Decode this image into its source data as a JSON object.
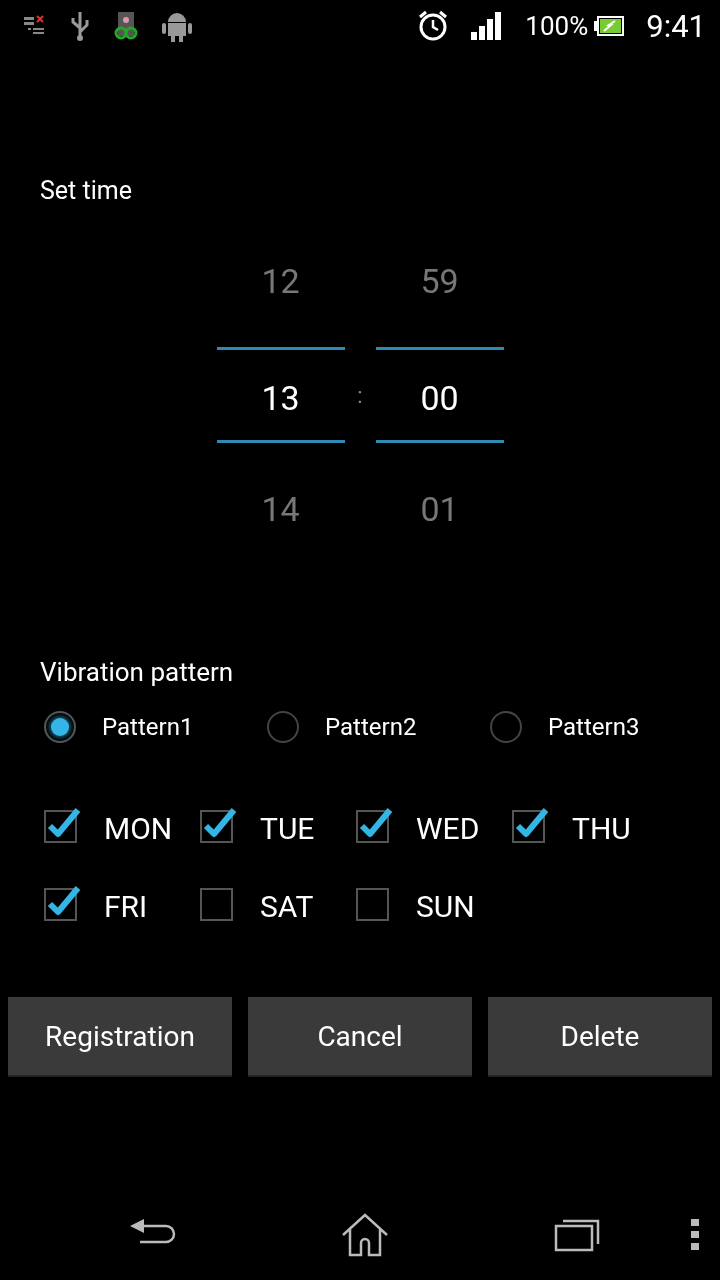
{
  "status_bar": {
    "battery_percent": "100%",
    "time": "9:41"
  },
  "title": "Set time",
  "time_picker": {
    "hours": [
      "12",
      "13",
      "14"
    ],
    "separator": ":",
    "minutes": [
      "59",
      "00",
      "01"
    ]
  },
  "vibration": {
    "label": "Vibration pattern",
    "patterns": [
      {
        "label": "Pattern1",
        "selected": true
      },
      {
        "label": "Pattern2",
        "selected": false
      },
      {
        "label": "Pattern3",
        "selected": false
      }
    ]
  },
  "days": [
    {
      "label": "MON",
      "checked": true
    },
    {
      "label": "TUE",
      "checked": true
    },
    {
      "label": "WED",
      "checked": true
    },
    {
      "label": "THU",
      "checked": true
    },
    {
      "label": "FRI",
      "checked": true
    },
    {
      "label": "SAT",
      "checked": false
    },
    {
      "label": "SUN",
      "checked": false
    }
  ],
  "buttons": [
    "Registration",
    "Cancel",
    "Delete"
  ]
}
